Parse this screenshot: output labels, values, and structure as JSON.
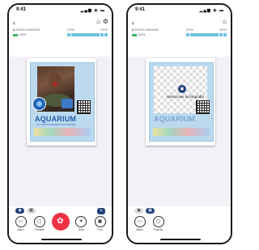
{
  "screens": [
    {
      "status_time": "9:41",
      "status_icons": "▂▄▆ ◉ ▬",
      "back_icon": "‹",
      "home_icon": "home-icon",
      "settings_icon": "gear-icon",
      "device_label": "INSTAX-00000000",
      "battery_label": "100%",
      "film_label": "Film",
      "film_count": "10/10",
      "brand": "AQUARIUM",
      "tagline": "Un mundo submarino por explorar",
      "tools": [
        {
          "label": "Marco"
        },
        {
          "label": "Plantilla"
        },
        {
          "label": "Texto"
        },
        {
          "label": "Foto"
        }
      ]
    },
    {
      "status_time": "9:41",
      "status_icons": "▂▄▆ ◉ ▬",
      "back_icon": "‹",
      "home_icon": "home-icon",
      "device_label": "INSTAX-00000000",
      "battery_label": "100%",
      "film_label": "Film",
      "film_count": "10/10",
      "brand": "AQUARIUM",
      "select_prompt": "Seleccione la fotografía",
      "tools": [
        {
          "label": "Marco"
        },
        {
          "label": "Plantilla"
        }
      ]
    }
  ],
  "colors": {
    "accent_blue": "#1f3f7a",
    "print_red": "#ee3344",
    "film_cyan": "#6fc4e0",
    "brand_blue": "#1f5ba8"
  }
}
